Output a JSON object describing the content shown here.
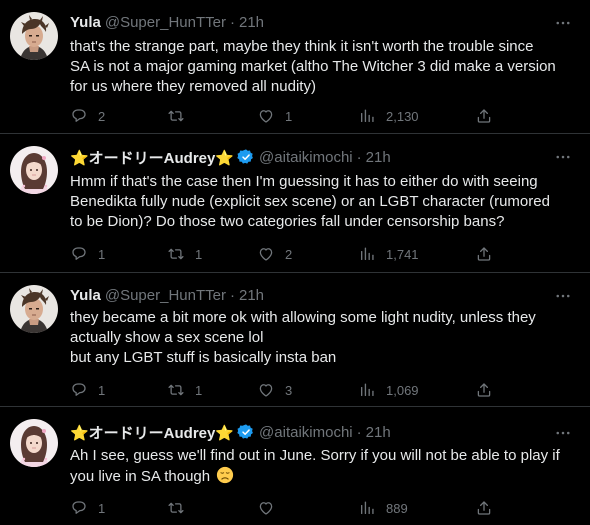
{
  "tweets": [
    {
      "display_name": "Yula",
      "handle": "@Super_HunTTer",
      "dot": "·",
      "time": "21h",
      "verified": false,
      "lines": [
        "that's the strange part, maybe they think it isn't worth the trouble since",
        "SA is not a major gaming market (altho The Witcher 3 did make a version",
        "for us where they removed all nudity)"
      ],
      "stats": {
        "replies": "2",
        "retweets": "",
        "likes": "1",
        "views": "2,130"
      }
    },
    {
      "display_name": "⭐オードリーAudrey⭐",
      "handle": "@aitaikimochi",
      "dot": "·",
      "time": "21h",
      "verified": true,
      "lines": [
        "Hmm if that's the case then I'm guessing it has to either do with seeing",
        "Benedikta fully nude (explicit sex scene) or an LGBT character (rumored",
        "to be Dion)? Do those two categories fall under censorship bans?"
      ],
      "stats": {
        "replies": "1",
        "retweets": "1",
        "likes": "2",
        "views": "1,741"
      }
    },
    {
      "display_name": "Yula",
      "handle": "@Super_HunTTer",
      "dot": "·",
      "time": "21h",
      "verified": false,
      "lines": [
        "they became a bit more ok with allowing some light nudity, unless they",
        "actually show a sex scene lol",
        "but any LGBT stuff is basically insta ban"
      ],
      "stats": {
        "replies": "1",
        "retweets": "1",
        "likes": "3",
        "views": "1,069"
      }
    },
    {
      "display_name": "⭐オードリーAudrey⭐",
      "handle": "@aitaikimochi",
      "dot": "·",
      "time": "21h",
      "verified": true,
      "lines": [
        "Ah I see, guess we'll find out in June. Sorry if you will not be able to play if",
        "you live in SA though"
      ],
      "emoji": "disappointed-face",
      "stats": {
        "replies": "1",
        "retweets": "",
        "likes": "",
        "views": "889"
      }
    }
  ],
  "colors": {
    "background": "#000000",
    "text": "#e7e9ea",
    "muted": "#71767b",
    "divider": "#2f3336",
    "verified": "#1d9bf0"
  }
}
